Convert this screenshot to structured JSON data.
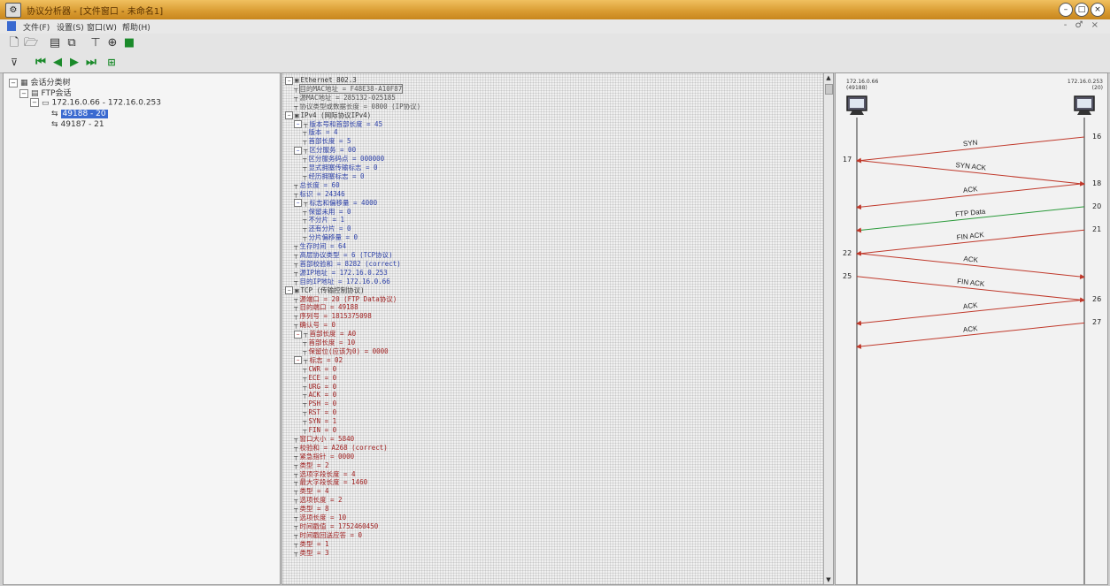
{
  "window": {
    "title": "协议分析器 - [文件窗口 - 未命名1]",
    "app_icon": "app-icon",
    "controls": [
      "minimize",
      "maximize",
      "close"
    ],
    "mdi_controls": "- ♂ ×"
  },
  "menu": [
    "文件(F)",
    "设置(S)",
    "窗口(W)",
    "帮助(H)"
  ],
  "toolbar1": [
    "new-file-icon",
    "open-folder-icon",
    "save-icon",
    "copy-icon",
    "filter-icon",
    "network-icon",
    "green-square-icon"
  ],
  "toolbar2": [
    "filter-toggle-icon",
    "first-icon",
    "previous-icon",
    "next-icon",
    "last-icon",
    "jump-icon"
  ],
  "session_tree": {
    "root": "会话分类树",
    "ftp": "FTP会话",
    "connection": "172.16.0.66 - 172.16.0.253",
    "sessions": [
      {
        "label": "49188 - 20",
        "selected": true
      },
      {
        "label": "49187 - 21",
        "selected": false
      }
    ]
  },
  "packet_tree": [
    {
      "level": 0,
      "kind": "hdr",
      "text": "Ethernet 802.3"
    },
    {
      "level": 1,
      "kind": "eth",
      "text": "目的MAC地址 = F48E38-A10F87",
      "highlight": true
    },
    {
      "level": 1,
      "kind": "eth",
      "text": "源MAC地址 = 285132-025185"
    },
    {
      "level": 1,
      "kind": "eth",
      "text": "协议类型或数据长度 = 0800 (IP协议)"
    },
    {
      "level": 0,
      "kind": "hdr",
      "text": "IPv4 (网际协议IPv4)"
    },
    {
      "level": 1,
      "kind": "ip",
      "text": "版本号和首部长度 = 45"
    },
    {
      "level": 2,
      "kind": "ip",
      "text": "版本 = 4"
    },
    {
      "level": 2,
      "kind": "ip",
      "text": "首部长度 = 5"
    },
    {
      "level": 1,
      "kind": "ip",
      "text": "区分服务 = 00"
    },
    {
      "level": 2,
      "kind": "ip",
      "text": "区分服务码点 = 000000"
    },
    {
      "level": 2,
      "kind": "ip",
      "text": "显式拥塞传输标志 = 0"
    },
    {
      "level": 2,
      "kind": "ip",
      "text": "经历拥塞标志 = 0"
    },
    {
      "level": 1,
      "kind": "ip",
      "text": "总长度 = 60"
    },
    {
      "level": 1,
      "kind": "ip",
      "text": "标识 = 24346"
    },
    {
      "level": 1,
      "kind": "ip",
      "text": "标志和偏移量 = 4000"
    },
    {
      "level": 2,
      "kind": "ip",
      "text": "保留未用 = 0"
    },
    {
      "level": 2,
      "kind": "ip",
      "text": "不分片 = 1"
    },
    {
      "level": 2,
      "kind": "ip",
      "text": "还有分片 = 0"
    },
    {
      "level": 2,
      "kind": "ip",
      "text": "分片偏移量 = 0"
    },
    {
      "level": 1,
      "kind": "ip",
      "text": "生存时间 = 64"
    },
    {
      "level": 1,
      "kind": "ip",
      "text": "高层协议类型 = 6 (TCP协议)"
    },
    {
      "level": 1,
      "kind": "ip",
      "text": "首部校验和 = 8282 (correct)"
    },
    {
      "level": 1,
      "kind": "ip",
      "text": "源IP地址 = 172.16.0.253"
    },
    {
      "level": 1,
      "kind": "ip",
      "text": "目的IP地址 = 172.16.0.66"
    },
    {
      "level": 0,
      "kind": "hdr",
      "text": "TCP (传输控制协议)"
    },
    {
      "level": 1,
      "kind": "tcp",
      "text": "源端口 = 20 (FTP Data协议)"
    },
    {
      "level": 1,
      "kind": "tcp",
      "text": "目的端口 = 49188"
    },
    {
      "level": 1,
      "kind": "tcp",
      "text": "序列号 = 1815375098"
    },
    {
      "level": 1,
      "kind": "tcp",
      "text": "确认号 = 0"
    },
    {
      "level": 1,
      "kind": "tcp",
      "text": "首部长度 = A0"
    },
    {
      "level": 2,
      "kind": "tcp",
      "text": "首部长度 = 10"
    },
    {
      "level": 2,
      "kind": "tcp",
      "text": "保留位(应该为0) = 0000"
    },
    {
      "level": 1,
      "kind": "tcp",
      "text": "标志 = 02"
    },
    {
      "level": 2,
      "kind": "tcp",
      "text": "CWR = 0"
    },
    {
      "level": 2,
      "kind": "tcp",
      "text": "ECE = 0"
    },
    {
      "level": 2,
      "kind": "tcp",
      "text": "URG = 0"
    },
    {
      "level": 2,
      "kind": "tcp",
      "text": "ACK = 0"
    },
    {
      "level": 2,
      "kind": "tcp",
      "text": "PSH = 0"
    },
    {
      "level": 2,
      "kind": "tcp",
      "text": "RST = 0"
    },
    {
      "level": 2,
      "kind": "tcp",
      "text": "SYN = 1"
    },
    {
      "level": 2,
      "kind": "tcp",
      "text": "FIN = 0"
    },
    {
      "level": 1,
      "kind": "tcp",
      "text": "窗口大小 = 5840"
    },
    {
      "level": 1,
      "kind": "tcp",
      "text": "校验和 = A268 (correct)"
    },
    {
      "level": 1,
      "kind": "tcp",
      "text": "紧急指针 = 0000"
    },
    {
      "level": 1,
      "kind": "tcp",
      "text": "类型 = 2"
    },
    {
      "level": 1,
      "kind": "tcp",
      "text": "选项字段长度 = 4"
    },
    {
      "level": 1,
      "kind": "tcp",
      "text": "最大字段长度 = 1460"
    },
    {
      "level": 1,
      "kind": "tcp",
      "text": "类型 = 4"
    },
    {
      "level": 1,
      "kind": "tcp",
      "text": "选项长度 = 2"
    },
    {
      "level": 1,
      "kind": "tcp",
      "text": "类型 = 8"
    },
    {
      "level": 1,
      "kind": "tcp",
      "text": "选项长度 = 10"
    },
    {
      "level": 1,
      "kind": "tcp",
      "text": "时间戳值 = 1752460450"
    },
    {
      "level": 1,
      "kind": "tcp",
      "text": "时间戳回送应答 = 0"
    },
    {
      "level": 1,
      "kind": "tcp",
      "text": "类型 = 1"
    },
    {
      "level": 1,
      "kind": "tcp",
      "text": "类型 = 3"
    }
  ],
  "flow": {
    "left_host": {
      "ip": "172.16.0.66",
      "port": "(49188)"
    },
    "right_host": {
      "ip": "172.16.0.253",
      "port": "(20)"
    },
    "arrows": [
      {
        "label": "SYN",
        "num": "16",
        "num_side": "right",
        "dir": "left"
      },
      {
        "label": "SYN ACK",
        "num": "17",
        "num_side": "left",
        "dir": "right"
      },
      {
        "label": "ACK",
        "num": "18",
        "num_side": "right",
        "dir": "left"
      },
      {
        "label": "FTP Data",
        "num": "20",
        "num_side": "right",
        "dir": "left"
      },
      {
        "label": "FIN ACK",
        "num": "21",
        "num_side": "right",
        "dir": "left"
      },
      {
        "label": "ACK",
        "num": "22",
        "num_side": "left",
        "dir": "right"
      },
      {
        "label": "FIN ACK",
        "num": "25",
        "num_side": "left",
        "dir": "right"
      },
      {
        "label": "ACK",
        "num": "26",
        "num_side": "right",
        "dir": "left"
      },
      {
        "label": "ACK",
        "num": "27",
        "num_side": "right",
        "dir": "left"
      }
    ],
    "arrow_color": "#c0392b",
    "green_color": "#2a9a3a"
  }
}
